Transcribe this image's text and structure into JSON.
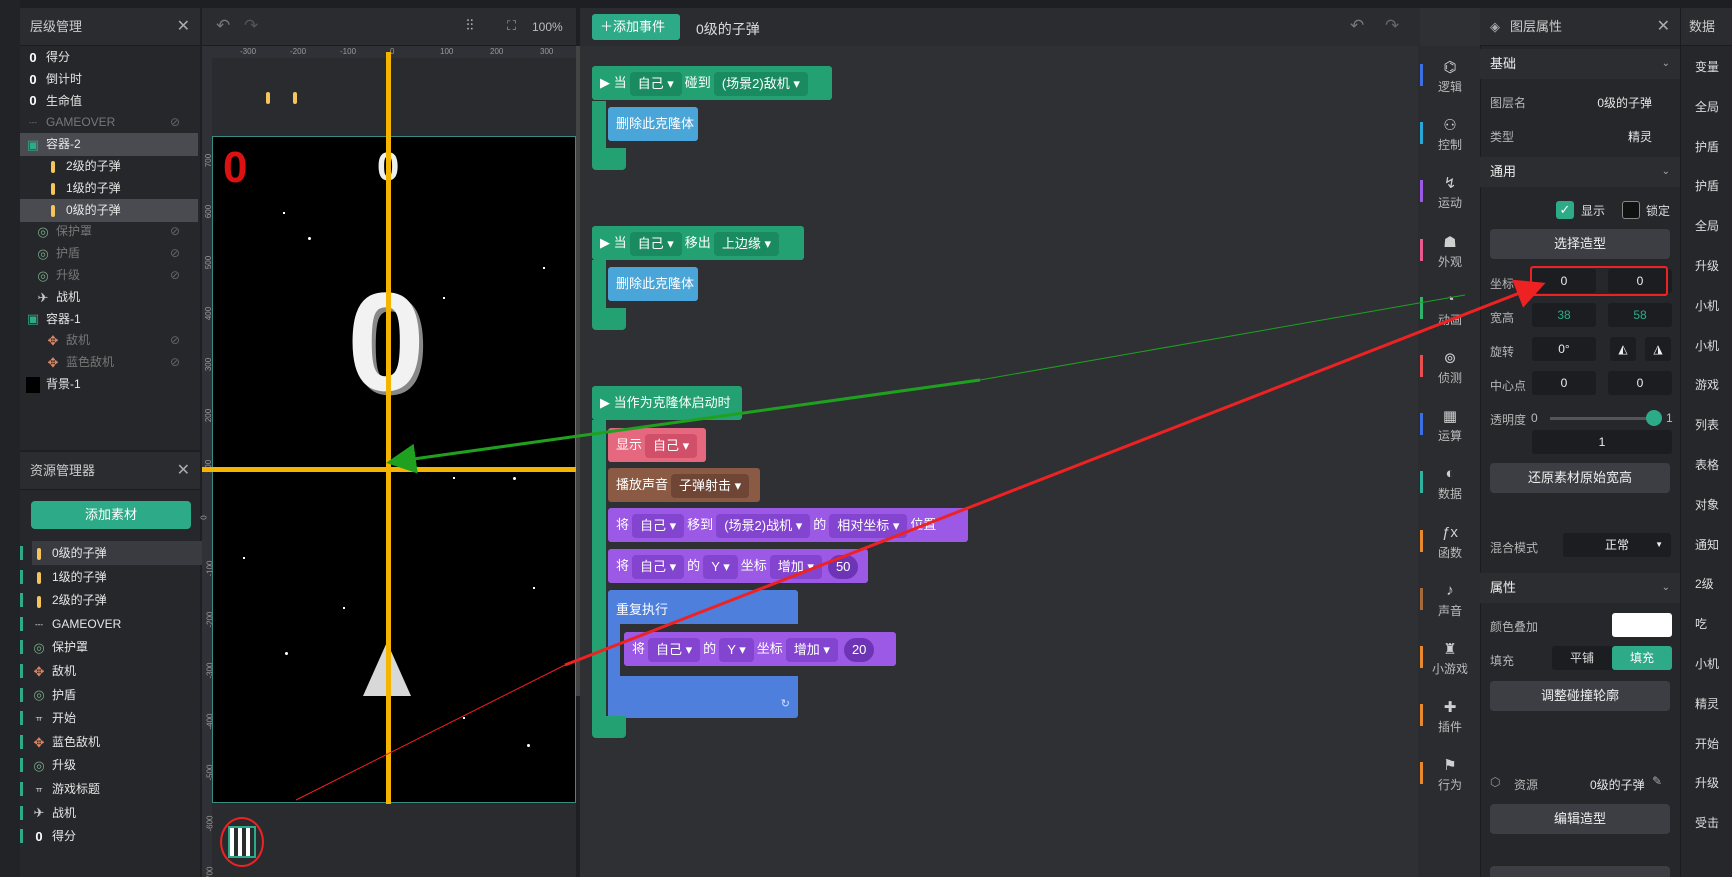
{
  "layer_panel": {
    "title": "层级管理",
    "items": [
      {
        "label": "得分",
        "icon": "0",
        "dim": false,
        "eye": false,
        "sel": false,
        "indent": 0
      },
      {
        "label": "倒计时",
        "icon": "0",
        "dim": false,
        "eye": false,
        "sel": false,
        "indent": 0
      },
      {
        "label": "生命值",
        "icon": "0",
        "dim": false,
        "eye": false,
        "sel": false,
        "indent": 0
      },
      {
        "label": "GAMEOVER",
        "icon": "---",
        "dim": true,
        "eye": true,
        "sel": false,
        "indent": 0
      },
      {
        "label": "容器-2",
        "icon": "box",
        "dim": false,
        "eye": false,
        "sel": true,
        "indent": 0
      },
      {
        "label": "2级的子弹",
        "icon": "bullet",
        "dim": false,
        "eye": false,
        "sel": false,
        "indent": 2
      },
      {
        "label": "1级的子弹",
        "icon": "bullet",
        "dim": false,
        "eye": false,
        "sel": false,
        "indent": 2
      },
      {
        "label": "0级的子弹",
        "icon": "bullet",
        "dim": false,
        "eye": false,
        "sel": true,
        "indent": 2
      },
      {
        "label": "保护罩",
        "icon": "ring",
        "dim": true,
        "eye": true,
        "sel": false,
        "indent": 1
      },
      {
        "label": "护盾",
        "icon": "ring",
        "dim": true,
        "eye": true,
        "sel": false,
        "indent": 1
      },
      {
        "label": "升级",
        "icon": "ring",
        "dim": true,
        "eye": true,
        "sel": false,
        "indent": 1
      },
      {
        "label": "战机",
        "icon": "plane",
        "dim": false,
        "eye": false,
        "sel": false,
        "indent": 1
      },
      {
        "label": "容器-1",
        "icon": "box",
        "dim": false,
        "eye": false,
        "sel": false,
        "indent": 0
      },
      {
        "label": "敌机",
        "icon": "enemy",
        "dim": true,
        "eye": true,
        "sel": false,
        "indent": 2
      },
      {
        "label": "蓝色敌机",
        "icon": "enemy",
        "dim": true,
        "eye": true,
        "sel": false,
        "indent": 2
      },
      {
        "label": "背景-1",
        "icon": "black",
        "dim": false,
        "eye": false,
        "sel": false,
        "indent": 0
      }
    ]
  },
  "asset_panel": {
    "title": "资源管理器",
    "add_label": "添加素材",
    "items": [
      "0级的子弹",
      "1级的子弹",
      "2级的子弹",
      "GAMEOVER",
      "保护罩",
      "敌机",
      "护盾",
      "开始",
      "蓝色敌机",
      "升级",
      "游戏标题",
      "战机",
      "得分"
    ],
    "icons": [
      "bullet",
      "bullet",
      "bullet",
      "---",
      "ring",
      "enemy",
      "ring",
      "text",
      "enemy",
      "ring",
      "text",
      "plane",
      "0"
    ]
  },
  "stage": {
    "zoom": "100%",
    "score": "0",
    "countdown": "0",
    "big_number": "0",
    "ruler_top": [
      "-300",
      "-200",
      "-100",
      "0",
      "100",
      "200",
      "300"
    ],
    "ruler_left": [
      "700",
      "600",
      "500",
      "400",
      "300",
      "200",
      "100",
      "0",
      "-100",
      "-200",
      "-300",
      "-400",
      "-500",
      "-600",
      "-700"
    ]
  },
  "editor": {
    "add_event": "添加事件",
    "sprite_title": "0级的子弹",
    "b1": {
      "when": "当",
      "self": "自己",
      "touch": "碰到",
      "target": "(场景2)敌机",
      "action": "删除此克隆体"
    },
    "b2": {
      "when": "当",
      "self": "自己",
      "leave": "移出",
      "edge": "上边缘",
      "action": "删除此克隆体"
    },
    "b3": {
      "hat": "当作为克隆体启动时",
      "show": "显示",
      "self": "自己",
      "sound": "播放声音",
      "sound_name": "子弹射击",
      "move1": "将",
      "move2": "移到",
      "move_target": "(场景2)战机",
      "of": "的",
      "coord_type": "相对坐标",
      "pos": "位置",
      "y_axis": "Y",
      "coord": "坐标",
      "inc": "增加",
      "val1": "50",
      "repeat": "重复执行",
      "val2": "20"
    }
  },
  "categories": [
    "逻辑",
    "控制",
    "运动",
    "外观",
    "动画",
    "侦测",
    "运算",
    "数据",
    "函数",
    "声音",
    "小游戏",
    "插件",
    "行为"
  ],
  "cat_colors": [
    "#3d6fe3",
    "#2aa7d6",
    "#9b59e6",
    "#e85a8c",
    "#2fb36a",
    "#e84f4f",
    "#3d6fe3",
    "#2fb3a0",
    "#e8892f",
    "#a36a3e",
    "#e8892f",
    "#e8892f",
    "#e8892f"
  ],
  "props": {
    "title": "图层属性",
    "basic": "基础",
    "layer_name_label": "图层名",
    "layer_name": "0级的子弹",
    "type_label": "类型",
    "type": "精灵",
    "general": "通用",
    "show": "显示",
    "lock": "锁定",
    "select_costume": "选择造型",
    "coord_label": "坐标",
    "x": "0",
    "y": "0",
    "size_label": "宽高",
    "w": "38",
    "h": "58",
    "rot_label": "旋转",
    "rot": "0°",
    "center_label": "中心点",
    "cx": "0",
    "cy": "0",
    "alpha_label": "透明度",
    "alpha_min": "0",
    "alpha_max": "1",
    "alpha": "1",
    "restore": "还原素材原始宽高",
    "blend_label": "混合模式",
    "blend": "正常",
    "attr": "属性",
    "color_label": "颜色叠加",
    "fill_label": "填充",
    "tile": "平铺",
    "fill": "填充",
    "collision": "调整碰撞轮廓",
    "resource_label": "资源",
    "resource": "0级的子弹",
    "edit_costume": "编辑造型"
  },
  "far_panel": {
    "title": "数据",
    "lines": [
      "变量",
      "全局",
      "护盾",
      "护盾",
      "全局",
      "升级",
      "小机",
      "小机",
      "游戏",
      "列表",
      "表格",
      "对象",
      "通知",
      "2级",
      "吃",
      "小机",
      "精灵",
      "开始",
      "升级",
      "受击"
    ]
  }
}
